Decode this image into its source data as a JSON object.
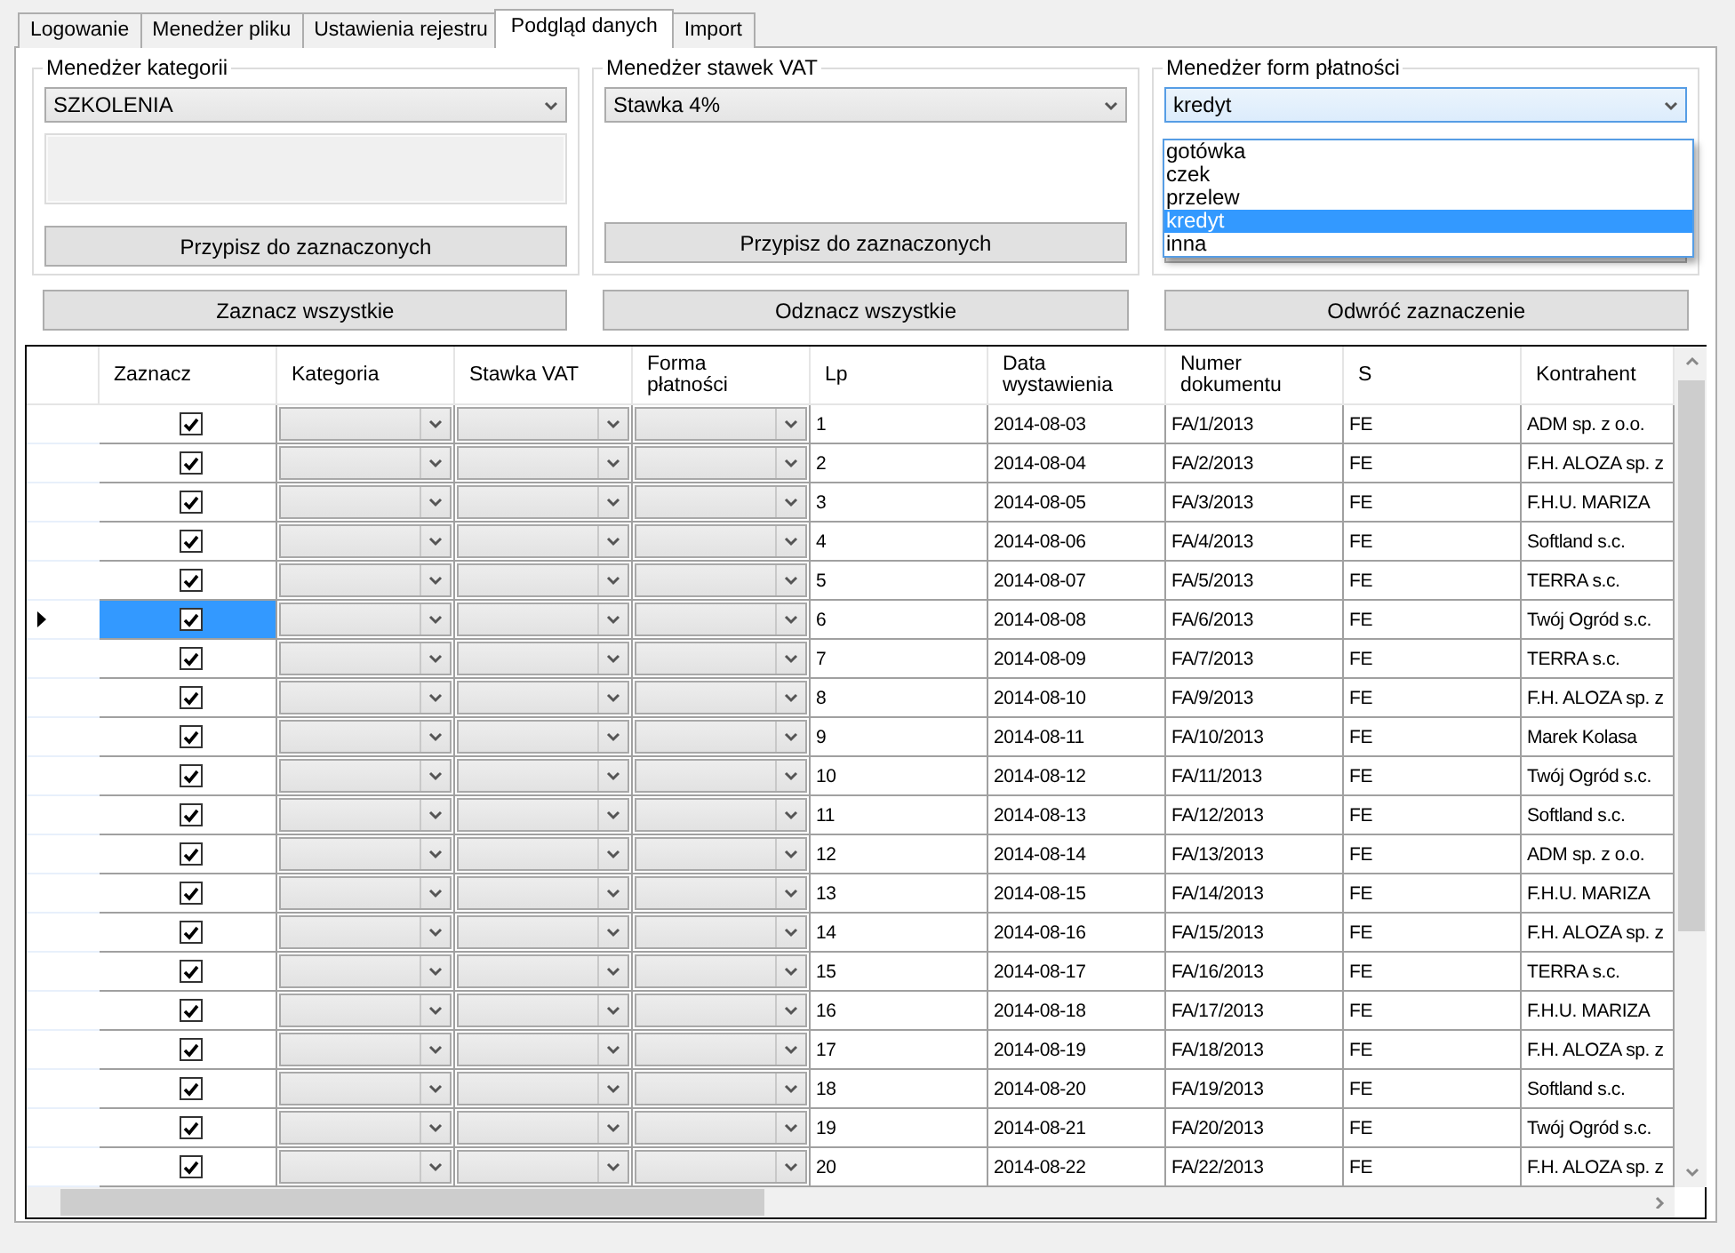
{
  "tabs": [
    {
      "label": "Logowanie",
      "selected": false
    },
    {
      "label": "Menedżer pliku",
      "selected": false
    },
    {
      "label": "Ustawienia rejestru",
      "selected": false
    },
    {
      "label": "Podgląd danych",
      "selected": true
    },
    {
      "label": "Import",
      "selected": false
    }
  ],
  "groups": [
    {
      "title": "Menedżer kategorii",
      "kind": "with_field",
      "combo": {
        "value": "SZKOLENIA",
        "focused": false
      },
      "button": {
        "label": "Przypisz do zaznaczonych"
      }
    },
    {
      "title": "Menedżer stawek VAT",
      "kind": "plain",
      "combo": {
        "value": "Stawka 4%",
        "focused": false
      },
      "button": {
        "label": "Przypisz do zaznaczonych"
      }
    },
    {
      "title": "Menedżer form płatności",
      "kind": "plain",
      "combo": {
        "value": "kredyt",
        "focused": true
      },
      "dropdown": [
        {
          "label": "gotówka",
          "selected": false
        },
        {
          "label": "czek",
          "selected": false
        },
        {
          "label": "przelew",
          "selected": false
        },
        {
          "label": "kredyt",
          "selected": true
        },
        {
          "label": "inna",
          "selected": false
        }
      ]
    }
  ],
  "actions": [
    "Zaznacz wszystkie",
    "Odznacz wszystkie",
    "Odwróć zaznaczenie"
  ],
  "table": {
    "columns": [
      {
        "label": "Zaznacz",
        "kind": "check"
      },
      {
        "label": "Kategoria",
        "kind": "combo"
      },
      {
        "label": "Stawka VAT",
        "kind": "combo"
      },
      {
        "label": "Forma płatności",
        "kind": "combo"
      },
      {
        "label": "Lp",
        "kind": "text"
      },
      {
        "label": "Data wystawienia",
        "kind": "text"
      },
      {
        "label": "Numer dokumentu",
        "kind": "text"
      },
      {
        "label": "S",
        "kind": "text"
      },
      {
        "label": "Kontrahent",
        "kind": "text"
      }
    ],
    "rows": [
      {
        "selected": false,
        "checked": true,
        "values": [
          "1",
          "2014-08-03",
          "FA/1/2013",
          "FE",
          "ADM sp. z o.o."
        ]
      },
      {
        "selected": false,
        "checked": true,
        "values": [
          "2",
          "2014-08-04",
          "FA/2/2013",
          "FE",
          "F.H. ALOZA sp. z"
        ]
      },
      {
        "selected": false,
        "checked": true,
        "values": [
          "3",
          "2014-08-05",
          "FA/3/2013",
          "FE",
          "F.H.U. MARIZA"
        ]
      },
      {
        "selected": false,
        "checked": true,
        "values": [
          "4",
          "2014-08-06",
          "FA/4/2013",
          "FE",
          "Softland s.c."
        ]
      },
      {
        "selected": false,
        "checked": true,
        "values": [
          "5",
          "2014-08-07",
          "FA/5/2013",
          "FE",
          "TERRA s.c."
        ]
      },
      {
        "selected": true,
        "checked": true,
        "values": [
          "6",
          "2014-08-08",
          "FA/6/2013",
          "FE",
          "Twój Ogród s.c."
        ]
      },
      {
        "selected": false,
        "checked": true,
        "values": [
          "7",
          "2014-08-09",
          "FA/7/2013",
          "FE",
          "TERRA s.c."
        ]
      },
      {
        "selected": false,
        "checked": true,
        "values": [
          "8",
          "2014-08-10",
          "FA/9/2013",
          "FE",
          "F.H. ALOZA sp. z"
        ]
      },
      {
        "selected": false,
        "checked": true,
        "values": [
          "9",
          "2014-08-11",
          "FA/10/2013",
          "FE",
          "Marek Kolasa"
        ]
      },
      {
        "selected": false,
        "checked": true,
        "values": [
          "10",
          "2014-08-12",
          "FA/11/2013",
          "FE",
          "Twój Ogród s.c."
        ]
      },
      {
        "selected": false,
        "checked": true,
        "values": [
          "11",
          "2014-08-13",
          "FA/12/2013",
          "FE",
          "Softland s.c."
        ]
      },
      {
        "selected": false,
        "checked": true,
        "values": [
          "12",
          "2014-08-14",
          "FA/13/2013",
          "FE",
          "ADM sp. z o.o."
        ]
      },
      {
        "selected": false,
        "checked": true,
        "values": [
          "13",
          "2014-08-15",
          "FA/14/2013",
          "FE",
          "F.H.U. MARIZA"
        ]
      },
      {
        "selected": false,
        "checked": true,
        "values": [
          "14",
          "2014-08-16",
          "FA/15/2013",
          "FE",
          "F.H. ALOZA sp. z"
        ]
      },
      {
        "selected": false,
        "checked": true,
        "values": [
          "15",
          "2014-08-17",
          "FA/16/2013",
          "FE",
          "TERRA s.c."
        ]
      },
      {
        "selected": false,
        "checked": true,
        "values": [
          "16",
          "2014-08-18",
          "FA/17/2013",
          "FE",
          "F.H.U. MARIZA"
        ]
      },
      {
        "selected": false,
        "checked": true,
        "values": [
          "17",
          "2014-08-19",
          "FA/18/2013",
          "FE",
          "F.H. ALOZA sp. z"
        ]
      },
      {
        "selected": false,
        "checked": true,
        "values": [
          "18",
          "2014-08-20",
          "FA/19/2013",
          "FE",
          "Softland s.c."
        ]
      },
      {
        "selected": false,
        "checked": true,
        "values": [
          "19",
          "2014-08-21",
          "FA/20/2013",
          "FE",
          "Twój Ogród s.c."
        ]
      },
      {
        "selected": false,
        "checked": true,
        "values": [
          "20",
          "2014-08-22",
          "FA/22/2013",
          "FE",
          "F.H. ALOZA sp. z"
        ]
      }
    ]
  }
}
